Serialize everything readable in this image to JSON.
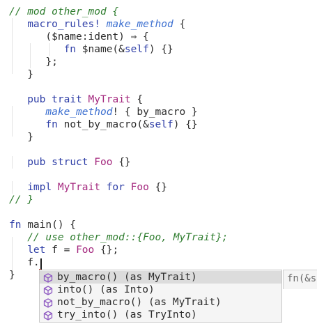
{
  "theme": {
    "comment": "#2f7d2f",
    "keyword": "#2f3fa7",
    "type": "#a4287e",
    "macro": "#3c6fd0",
    "plain": "#2c2c2c",
    "icon": "#8f5bc2"
  },
  "code_lines": [
    [
      {
        "t": "// mod other_mod {",
        "c": "comment"
      }
    ],
    [
      {
        "t": "   "
      },
      {
        "t": "macro_rules!",
        "c": "keyword"
      },
      {
        "t": " "
      },
      {
        "t": "make_method",
        "c": "macro-i"
      },
      {
        "t": " {"
      }
    ],
    [
      {
        "t": "      ($name:ident) ⇒ {"
      }
    ],
    [
      {
        "t": "         "
      },
      {
        "t": "fn",
        "c": "keyword"
      },
      {
        "t": " $name(&"
      },
      {
        "t": "self",
        "c": "keyword"
      },
      {
        "t": ") {}"
      }
    ],
    [
      {
        "t": "      };"
      }
    ],
    [
      {
        "t": "   }"
      }
    ],
    [],
    [
      {
        "t": "   "
      },
      {
        "t": "pub",
        "c": "keyword"
      },
      {
        "t": " "
      },
      {
        "t": "trait",
        "c": "keyword"
      },
      {
        "t": " "
      },
      {
        "t": "MyTrait",
        "c": "type"
      },
      {
        "t": " {"
      }
    ],
    [
      {
        "t": "      "
      },
      {
        "t": "make_method",
        "c": "macro-i"
      },
      {
        "t": "! { by_macro }"
      }
    ],
    [
      {
        "t": "      "
      },
      {
        "t": "fn",
        "c": "keyword"
      },
      {
        "t": " not_by_macro(&"
      },
      {
        "t": "self",
        "c": "keyword"
      },
      {
        "t": ") {}"
      }
    ],
    [
      {
        "t": "   }"
      }
    ],
    [],
    [
      {
        "t": "   "
      },
      {
        "t": "pub",
        "c": "keyword"
      },
      {
        "t": " "
      },
      {
        "t": "struct",
        "c": "keyword"
      },
      {
        "t": " "
      },
      {
        "t": "Foo",
        "c": "type"
      },
      {
        "t": " {}"
      }
    ],
    [],
    [
      {
        "t": "   "
      },
      {
        "t": "impl",
        "c": "keyword"
      },
      {
        "t": " "
      },
      {
        "t": "MyTrait",
        "c": "type"
      },
      {
        "t": " "
      },
      {
        "t": "for",
        "c": "keyword"
      },
      {
        "t": " "
      },
      {
        "t": "Foo",
        "c": "type"
      },
      {
        "t": " {}"
      }
    ],
    [
      {
        "t": "// }",
        "c": "comment"
      }
    ],
    [],
    [
      {
        "t": "fn",
        "c": "keyword"
      },
      {
        "t": " main() {"
      }
    ],
    [
      {
        "t": "   "
      },
      {
        "t": "// use other_mod::{Foo, MyTrait};",
        "c": "comment"
      }
    ],
    [
      {
        "t": "   "
      },
      {
        "t": "let",
        "c": "keyword"
      },
      {
        "t": " f = "
      },
      {
        "t": "Foo",
        "c": "type"
      },
      {
        "t": " {};"
      }
    ],
    [
      {
        "t": "   f."
      }
    ],
    [
      {
        "t": "}"
      }
    ]
  ],
  "completion": {
    "items": [
      {
        "label": "by_macro() (as MyTrait)",
        "selected": true
      },
      {
        "label": "into() (as Into)",
        "selected": false
      },
      {
        "label": "not_by_macro() (as MyTrait)",
        "selected": false
      },
      {
        "label": "try_into() (as TryInto)",
        "selected": false
      }
    ],
    "item_icon": "method-cube-icon",
    "detail": "fn(&s"
  }
}
